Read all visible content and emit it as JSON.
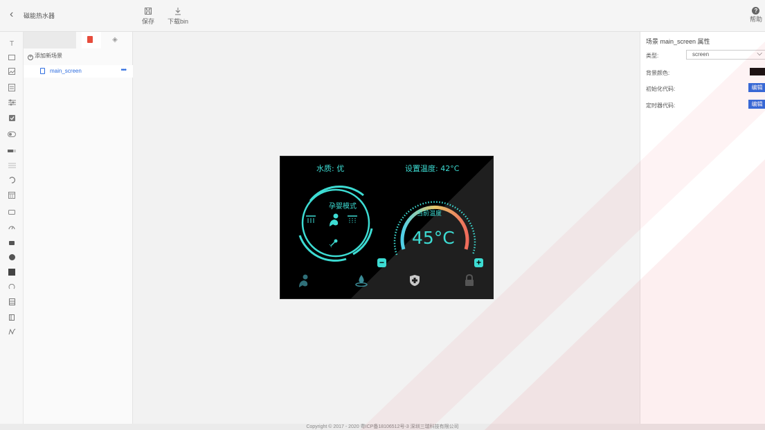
{
  "header": {
    "back_glyph": "‹",
    "title": "磁能热水器",
    "save_label": "保存",
    "download_label": "下载bin",
    "help_label": "帮助"
  },
  "toolbox": {
    "icons": [
      "text-icon",
      "button-icon",
      "image-icon",
      "image-button-icon",
      "slider-icon",
      "checkbox-icon",
      "switch-icon",
      "progress-bar-icon",
      "list-icon",
      "arc-icon",
      "calendar-icon",
      "label-icon",
      "gauge-icon",
      "bar-icon",
      "led-icon",
      "container-icon",
      "spinner-icon",
      "textarea-icon",
      "dropdown-icon",
      "line-icon"
    ]
  },
  "scene_panel": {
    "add_scene_label": "添加新场景",
    "scenes": [
      {
        "name": "main_screen",
        "more": "•••"
      }
    ]
  },
  "device_screen": {
    "water_quality": "水质: 优",
    "set_temperature": "设置温度: 42°C",
    "mode": "孕婴模式",
    "current_temp_label": "当前温度",
    "current_temp": "45°C",
    "minus": "−",
    "plus": "+"
  },
  "props": {
    "title": "场景 main_screen 属性",
    "type_label": "类型:",
    "type_value": "screen",
    "bg_color_label": "背景颜色:",
    "bg_color": "#111111",
    "init_code_label": "初始化代码:",
    "timer_code_label": "定时器代码:",
    "edit_label": "编辑"
  },
  "footer": {
    "copyright": "Copyright © 2017 - 2020 粤ICP备18106512号-3 深圳三瑞科技有限公司"
  },
  "colors": {
    "accent": "#2d6cdf",
    "screen_text": "#3ddcd3",
    "watermark": "#e8323c"
  }
}
